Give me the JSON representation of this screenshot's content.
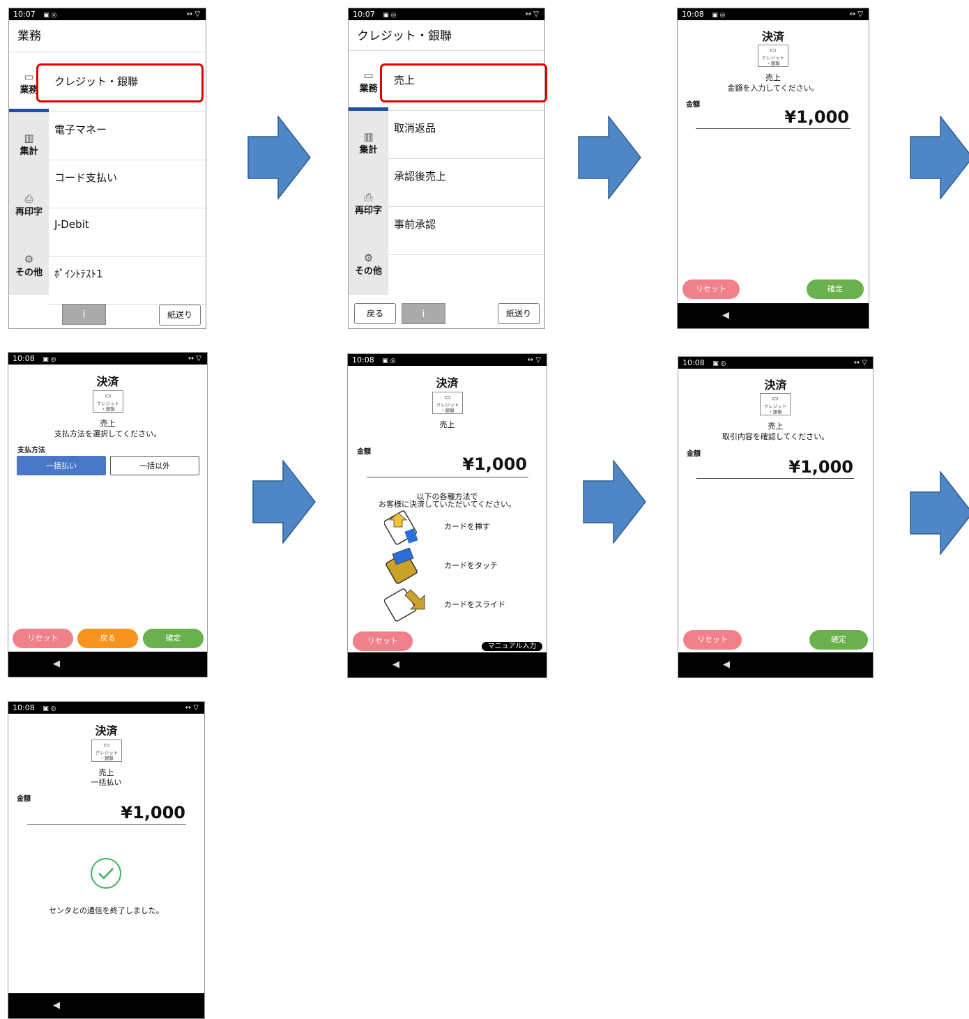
{
  "status": {
    "time_1": "10:07",
    "time_2": "10:07",
    "time_later": "10:08",
    "icons": "▣ ◎",
    "right": "↔ ▽"
  },
  "nav": {
    "back": "◀"
  },
  "screen1": {
    "title": "業務",
    "side": [
      {
        "icon": "card-icon",
        "label": "業務"
      },
      {
        "icon": "chart-icon",
        "label": "集計"
      },
      {
        "icon": "printer-icon",
        "label": "再印字"
      },
      {
        "icon": "gear-icon",
        "label": "その他"
      }
    ],
    "items": [
      "クレジット・銀聯",
      "電子マネー",
      "コード支払い",
      "J-Debit",
      "ﾎﾟｲﾝﾄﾃｽﾄ1"
    ],
    "info": "i",
    "paper_feed": "紙送り"
  },
  "screen2": {
    "title": "クレジット・銀聯",
    "items": [
      "売上",
      "取消返品",
      "承認後売上",
      "事前承認"
    ],
    "back": "戻る",
    "info": "i",
    "paper_feed": "紙送り"
  },
  "pay": {
    "title": "決済",
    "card_icon_text_1": "クレジット",
    "card_icon_text_2": "・銀聯",
    "sale": "売上",
    "amount_label": "金額",
    "amount": "¥1,000",
    "reset": "リセット",
    "confirm": "確定",
    "back": "戻る"
  },
  "screen3": {
    "prompt": "金額を入力してください。"
  },
  "screen4": {
    "prompt": "支払方法を選択してください。",
    "method_label": "支払方法",
    "lump": "一括払い",
    "other": "一括以外"
  },
  "screen5": {
    "prompt_1": "以下の各種方法で",
    "prompt_2": "お客様に決済していただいてください。",
    "insert": "カードを挿す",
    "touch": "カードをタッチ",
    "swipe": "カードをスライド",
    "manual": "マニュアル入力"
  },
  "screen6": {
    "prompt": "取引内容を確認してください。"
  },
  "screen7": {
    "method": "一括払い",
    "done": "センタとの通信を終了しました。"
  },
  "colors": {
    "arrow": "#4f86c6",
    "highlight": "#e00000",
    "ok": "#6ab04c",
    "reset": "#f0808a",
    "back": "#f7941d",
    "select": "#4a78c8"
  }
}
